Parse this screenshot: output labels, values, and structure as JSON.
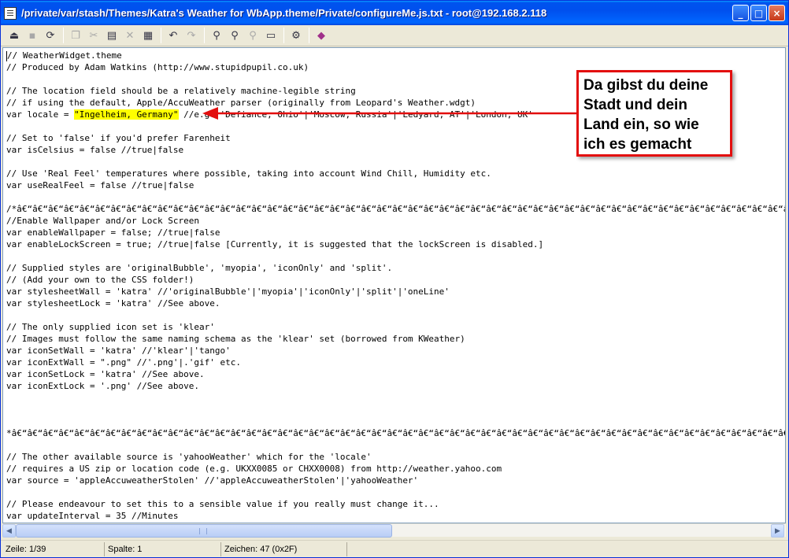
{
  "window": {
    "title": "/private/var/stash/Themes/Katra's Weather for WbApp.theme/Private/configureMe.js.txt - root@192.168.2.118",
    "controls": {
      "minimize": "_",
      "maximize": "□",
      "close": "×"
    }
  },
  "toolbar": {
    "icons": [
      "disconnect-icon",
      "save-icon",
      "refresh-icon",
      "copy-icon",
      "cut-icon",
      "paste-icon",
      "delete-icon",
      "select-all-icon",
      "undo-icon",
      "redo-icon",
      "find-icon",
      "find-next-icon",
      "replace-icon",
      "goto-icon",
      "settings-icon",
      "help-icon"
    ]
  },
  "editor": {
    "lines": [
      "// WeatherWidget.theme",
      "// Produced by Adam Watkins (http://www.stupidpupil.co.uk)",
      "",
      "// The location field should be a relatively machine-legible string",
      "// if using the default, Apple/AccuWeather parser (originally from Leopard's Weather.wdgt)",
      "",
      "",
      "// Set to 'false' if you'd prefer Farenheit",
      "var isCelsius = false //true|false",
      "",
      "// Use 'Real Feel' temperatures where possible, taking into account Wind Chill, Humidity etc.",
      "var useRealFeel = false //true|false",
      "",
      "/*â€“â€“â€“â€“â€“â€“â€“â€“â€“â€“â€“â€“â€“â€“â€“â€“â€“â€“â€“â€“â€“â€“â€“â€“â€“â€“â€“â€“â€“â€“â€“â€“â€“â€“â€“â€“â€“â€“â€“â€“â€“â€“â€“â€“â€“â€“â€“â€“â€“â€“â€“â€“â€“â€“",
      "//Enable Wallpaper and/or Lock Screen",
      "var enableWallpaper = false; //true|false",
      "var enableLockScreen = true; //true|false [Currently, it is suggested that the lockScreen is disabled.]",
      "",
      "// Supplied styles are 'originalBubble', 'myopia', 'iconOnly' and 'split'.",
      "// (Add your own to the CSS folder!)",
      "var stylesheetWall = 'katra' //'originalBubble'|'myopia'|'iconOnly'|'split'|'oneLine'",
      "var stylesheetLock = 'katra' //See above.",
      "",
      "// The only supplied icon set is 'klear'",
      "// Images must follow the same naming schema as the 'klear' set (borrowed from KWeather)",
      "var iconSetWall = 'katra' //'klear'|'tango'",
      "var iconExtWall = \".png\" //'.png'|.'gif' etc.",
      "var iconSetLock = 'katra' //See above.",
      "var iconExtLock = '.png' //See above.",
      "",
      "",
      "",
      "*â€“â€“â€“â€“â€“â€“â€“â€“â€“â€“â€“â€“â€“â€“â€“â€“â€“â€“â€“â€“â€“â€“â€“â€“â€“â€“â€“â€“â€“â€“â€“â€“â€“â€“â€“â€“â€“â€“â€“â€“â€“â€“â€“â€“â€“â€“â€“â€“â€“â€“â€“â€“â€“â€“â€“â€“",
      "",
      "// The other available source is 'yahooWeather' which for the 'locale'",
      "// requires a US zip or location code (e.g. UKXX0085 or CHXX0008) from http://weather.yahoo.com",
      "var source = 'appleAccuweatherStolen' //'appleAccuweatherStolen'|'yahooWeather'",
      "",
      "// Please endeavour to set this to a sensible value if you really must change it...",
      "var updateInterval = 35 //Minutes"
    ],
    "locale_line": {
      "prefix": "var locale = ",
      "value": "\"Ingelheim, Germany\"",
      "suffix": "//e.g. 'Defiance, Ohio'|'Moscow, Russia'|'Ledyard, AT'|'London, UK'"
    }
  },
  "annotation": {
    "text_lines": [
      "Da gibst du deine",
      "Stadt und dein",
      "Land ein, so wie",
      "ich es gemacht"
    ],
    "color": "#e30e0e"
  },
  "statusbar": {
    "line": "Zeile: 1/39",
    "column": "Spalte: 1",
    "chars": "Zeichen: 47 (0x2F)"
  },
  "colors": {
    "titlebar": "#0054e3",
    "highlight": "#ffff00",
    "chrome": "#ece9d8"
  }
}
